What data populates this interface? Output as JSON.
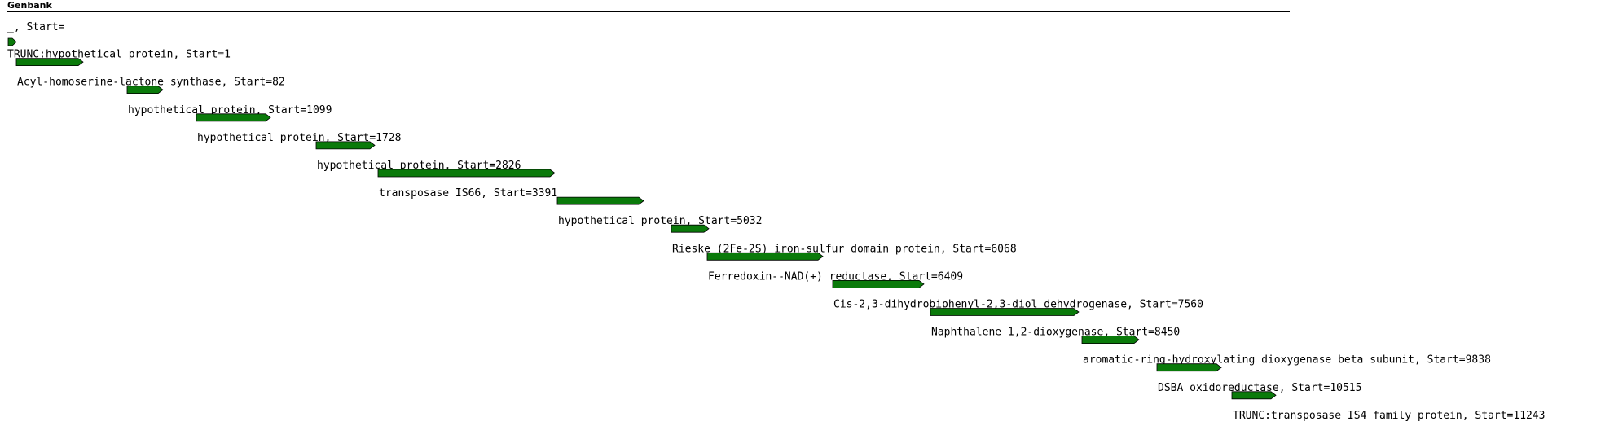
{
  "track": {
    "title": "Genbank",
    "arrow_color": "#0a7a0a",
    "arrow_stroke": "#000000"
  },
  "features": [
    {
      "name": "_",
      "start": null,
      "label": "_, Start=",
      "strand": "+",
      "tiny": true
    },
    {
      "name": "TRUNC:hypothetical protein",
      "start": 1,
      "label": "TRUNC:hypothetical protein, Start=1",
      "strand": "+"
    },
    {
      "name": "Acyl-homoserine-lactone synthase",
      "start": 82,
      "label": "Acyl-homoserine-lactone synthase, Start=82",
      "strand": "+"
    },
    {
      "name": "hypothetical protein",
      "start": 1099,
      "label": "hypothetical protein, Start=1099",
      "strand": "+"
    },
    {
      "name": "hypothetical protein",
      "start": 1728,
      "label": "hypothetical protein, Start=1728",
      "strand": "+"
    },
    {
      "name": "hypothetical protein",
      "start": 2826,
      "label": "hypothetical protein, Start=2826",
      "strand": "+"
    },
    {
      "name": "transposase IS66",
      "start": 3391,
      "label": "transposase IS66, Start=3391",
      "strand": "+"
    },
    {
      "name": "hypothetical protein",
      "start": 5032,
      "label": "hypothetical protein, Start=5032",
      "strand": "+"
    },
    {
      "name": "Rieske (2Fe-2S) iron-sulfur domain protein",
      "start": 6068,
      "label": "Rieske (2Fe-2S) iron-sulfur domain protein, Start=6068",
      "strand": "+"
    },
    {
      "name": "Ferredoxin--NAD(+) reductase",
      "start": 6409,
      "label": "Ferredoxin--NAD(+) reductase, Start=6409",
      "strand": "+"
    },
    {
      "name": "Cis-2,3-dihydrobiphenyl-2,3-diol dehydrogenase",
      "start": 7560,
      "label": "Cis-2,3-dihydrobiphenyl-2,3-diol dehydrogenase, Start=7560",
      "strand": "+"
    },
    {
      "name": "Naphthalene 1,2-dioxygenase",
      "start": 8450,
      "label": "Naphthalene 1,2-dioxygenase, Start=8450",
      "strand": "+"
    },
    {
      "name": "aromatic-ring-hydroxylating dioxygenase beta subunit",
      "start": 9838,
      "label": "aromatic-ring-hydroxylating dioxygenase beta subunit, Start=9838",
      "strand": "+"
    },
    {
      "name": "DSBA oxidoreductase",
      "start": 10515,
      "label": "DSBA oxidoreductase, Start=10515",
      "strand": "+"
    },
    {
      "name": "TRUNC:transposase IS4 family protein",
      "start": 11243,
      "label": "TRUNC:transposase IS4 family protein, Start=11243",
      "strand": "+"
    }
  ]
}
